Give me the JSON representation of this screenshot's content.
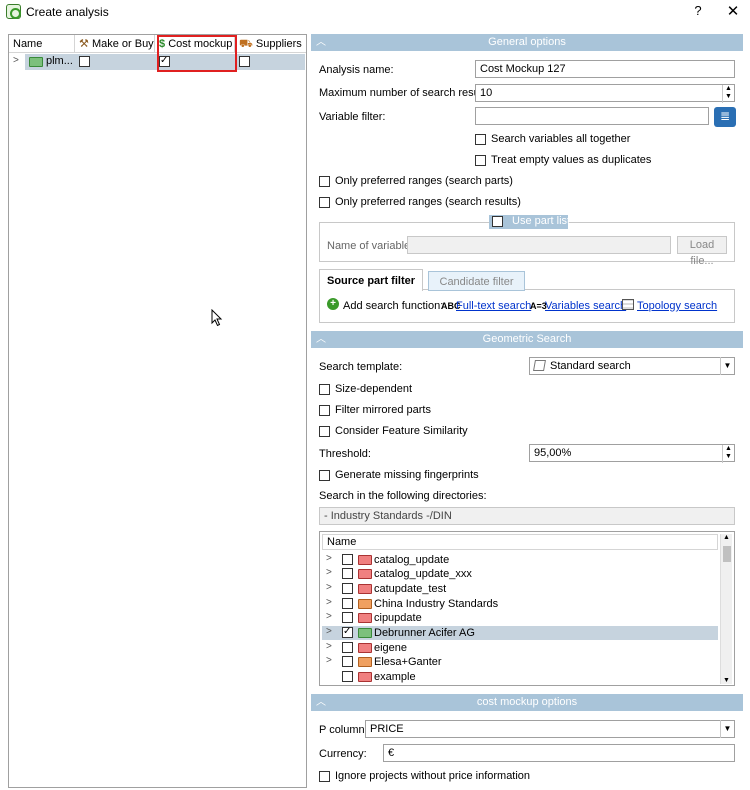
{
  "window": {
    "title": "Create analysis",
    "help": "?",
    "close": "✕"
  },
  "tree": {
    "columns": [
      "Name",
      "Make or Buy",
      "Cost mockup",
      "Suppliers"
    ],
    "row": {
      "expander": ">",
      "name": "plm...",
      "make_or_buy": false,
      "cost_mockup": true,
      "suppliers": false
    }
  },
  "general": {
    "header": "General options",
    "analysis_name_label": "Analysis name:",
    "analysis_name_value": "Cost Mockup 127",
    "max_results_label": "Maximum number of search result:",
    "max_results_value": "10",
    "variable_filter_label": "Variable filter:",
    "variable_filter_value": "",
    "search_vars_together": "Search variables all together",
    "treat_empty_duplicates": "Treat empty values as duplicates",
    "only_pref_parts": "Only preferred ranges (search parts)",
    "only_pref_results": "Only preferred ranges (search results)",
    "use_part_list": "Use part list",
    "name_of_variable_label": "Name of variable:",
    "load_file": "Load file...",
    "tabs": [
      "Source part filter",
      "Candidate filter"
    ],
    "add_search_function": "Add search function:",
    "fulltext_icon": "ABC",
    "fulltext": "Full-text search",
    "variables_icon": "A=3",
    "variables": "Variables search",
    "topology": "Topology search"
  },
  "geometric": {
    "header": "Geometric Search",
    "template_label": "Search template:",
    "template_value": "Standard search",
    "size_dependent": "Size-dependent",
    "filter_mirrored": "Filter mirrored parts",
    "consider_feature": "Consider Feature Similarity",
    "threshold_label": "Threshold:",
    "threshold_value": "95,00%",
    "generate_fingerprints": "Generate missing fingerprints",
    "search_dirs_label": "Search in the following directories:",
    "selected_dir": "- Industry Standards -/DIN",
    "dir_column": "Name",
    "directories": [
      {
        "name": "catalog_update",
        "checked": false,
        "color": "red",
        "expandable": true
      },
      {
        "name": "catalog_update_xxx",
        "checked": false,
        "color": "red",
        "expandable": true
      },
      {
        "name": "catupdate_test",
        "checked": false,
        "color": "red",
        "expandable": true
      },
      {
        "name": "China Industry Standards",
        "checked": false,
        "color": "orange",
        "expandable": true
      },
      {
        "name": "cipupdate",
        "checked": false,
        "color": "red",
        "expandable": true
      },
      {
        "name": "Debrunner Acifer AG",
        "checked": true,
        "color": "green",
        "expandable": true,
        "selected": true
      },
      {
        "name": "eigene",
        "checked": false,
        "color": "red",
        "expandable": true
      },
      {
        "name": "Elesa+Ganter",
        "checked": false,
        "color": "orange",
        "expandable": true
      },
      {
        "name": "example",
        "checked": false,
        "color": "red",
        "expandable": false
      }
    ]
  },
  "cost": {
    "header": "cost mockup options",
    "p_column_label": "P column:",
    "p_column_value": "PRICE",
    "currency_label": "Currency:",
    "currency_value": "€",
    "ignore_projects": "Ignore projects without price information"
  }
}
